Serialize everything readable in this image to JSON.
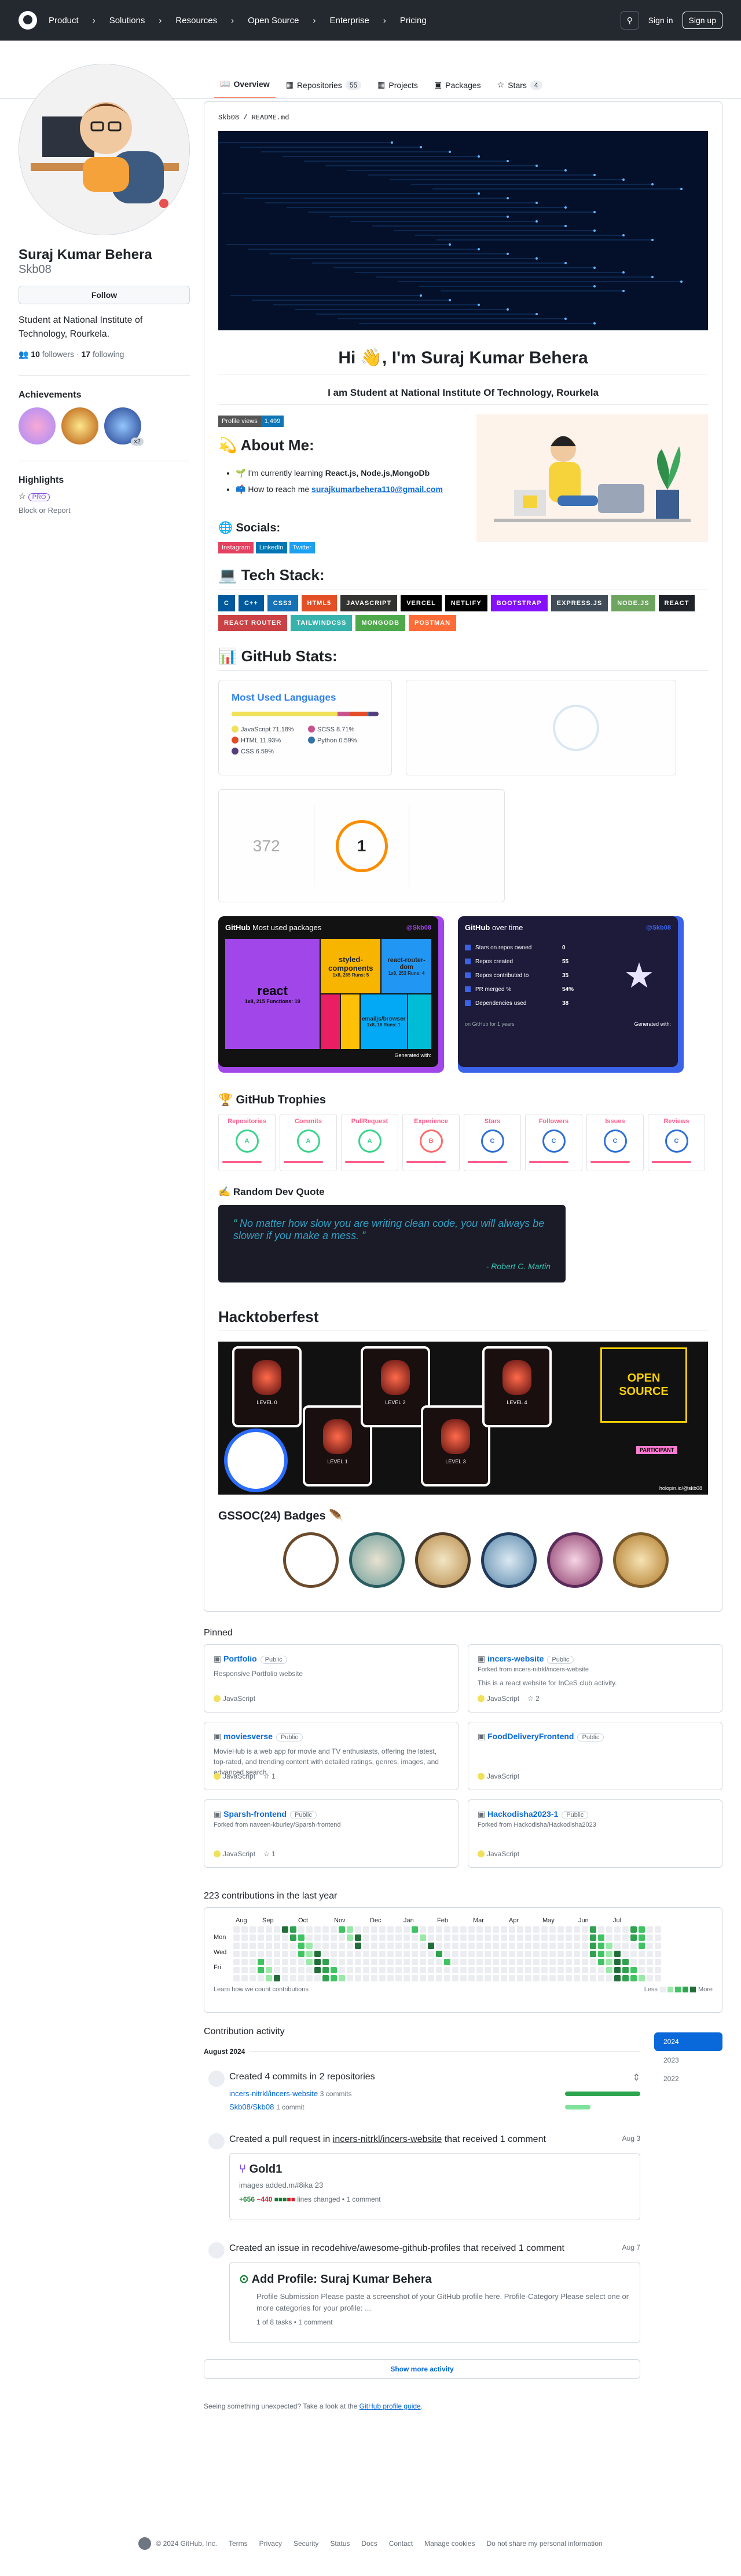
{
  "header": {
    "nav": [
      "Product",
      "Solutions",
      "Resources",
      "Open Source",
      "Enterprise",
      "Pricing"
    ],
    "sign_in": "Sign in",
    "sign_up": "Sign up",
    "search_key": "/"
  },
  "tabs": [
    {
      "label": "Overview"
    },
    {
      "label": "Repositories",
      "count": "55"
    },
    {
      "label": "Projects"
    },
    {
      "label": "Packages"
    },
    {
      "label": "Stars",
      "count": "4"
    }
  ],
  "profile": {
    "name": "Suraj Kumar Behera",
    "login": "Skb08",
    "follow": "Follow",
    "bio": "Student at National Institute of Technology, Rourkela.",
    "followers": "10",
    "followers_label": "followers",
    "following": "17",
    "following_label": "following",
    "achievements_title": "Achievements",
    "achievement_count": "x2",
    "highlights_title": "Highlights",
    "pro": "PRO",
    "block": "Block or Report"
  },
  "readme": {
    "path": "Skb08 / README.md",
    "greeting": "Hi 👋, I'm Suraj Kumar Behera",
    "subtitle": "I am Student at National Institute Of Technology, Rourkela",
    "profile_views_label": "Profile views",
    "profile_views": "1,499",
    "about_title": "💫 About Me:",
    "about_items": [
      {
        "pre": "🌱 I'm currently learning ",
        "bold": "React.js, Node.js,MongoDb"
      },
      {
        "pre": "📫 How to reach me ",
        "link": "surajkumarbehera110@gmail.com"
      }
    ],
    "socials_title": "🌐 Socials:",
    "socials": [
      {
        "label": "Instagram",
        "color": "#e4405f"
      },
      {
        "label": "LinkedIn",
        "color": "#0077b5"
      },
      {
        "label": "Twitter",
        "color": "#1ca0f1"
      }
    ],
    "tech_title": "💻 Tech Stack:",
    "tech": [
      {
        "label": "C",
        "color": "#00599c"
      },
      {
        "label": "C++",
        "color": "#00599c"
      },
      {
        "label": "CSS3",
        "color": "#1572b6"
      },
      {
        "label": "HTML5",
        "color": "#e34f26"
      },
      {
        "label": "JAVASCRIPT",
        "color": "#323330"
      },
      {
        "label": "VERCEL",
        "color": "#000000"
      },
      {
        "label": "NETLIFY",
        "color": "#000000"
      },
      {
        "label": "BOOTSTRAP",
        "color": "#8511fa"
      },
      {
        "label": "EXPRESS.JS",
        "color": "#404d59"
      },
      {
        "label": "NODE.JS",
        "color": "#6da55f"
      },
      {
        "label": "REACT",
        "color": "#20232a"
      },
      {
        "label": "REACT ROUTER",
        "color": "#ca4245"
      },
      {
        "label": "TAILWINDCSS",
        "color": "#38b2ac"
      },
      {
        "label": "MONGODB",
        "color": "#4ea94b"
      },
      {
        "label": "POSTMAN",
        "color": "#ff6c37"
      }
    ],
    "stats_title": "📊 GitHub Stats:",
    "langs_title": "Most Used Languages",
    "langs": [
      {
        "name": "JavaScript",
        "pct": "71.18%",
        "color": "#f1e05a"
      },
      {
        "name": "SCSS",
        "pct": "8.71%",
        "color": "#c6538c"
      },
      {
        "name": "HTML",
        "pct": "11.93%",
        "color": "#e34c26"
      },
      {
        "name": "Python",
        "pct": "0.59%",
        "color": "#3572a5"
      },
      {
        "name": "CSS",
        "pct": "6.59%",
        "color": "#563d7c"
      }
    ],
    "total": "372",
    "streak": "1",
    "packages_title": "Most used packages",
    "packages_user": "@Skb08",
    "packages": [
      {
        "name": "react",
        "sub": "1x8, 215 Functions: 19"
      },
      {
        "name": "styled-components",
        "sub": "1x8, 265 Runs: 5"
      },
      {
        "name": "react-router-dom",
        "sub": "1x8, 253 Runs: 4"
      },
      {
        "name": "emailjs/browser",
        "sub": "1x8, 18 Runs: 1"
      }
    ],
    "generated": "Generated with:",
    "overtime_title": "over time",
    "overtime_rows": [
      {
        "label": "Stars on repos owned",
        "value": "0"
      },
      {
        "label": "Repos created",
        "value": "55"
      },
      {
        "label": "Repos contributed to",
        "value": "35"
      },
      {
        "label": "PR merged %",
        "value": "54%"
      },
      {
        "label": "Dependencies used",
        "value": "38"
      }
    ],
    "overtime_period": "on GitHub for 1 years",
    "trophies_title": "🏆 GitHub Trophies",
    "trophies": [
      {
        "label": "Repositories",
        "rank": "A"
      },
      {
        "label": "Commits",
        "rank": "A"
      },
      {
        "label": "PullRequest",
        "rank": "A"
      },
      {
        "label": "Experience",
        "rank": "B"
      },
      {
        "label": "Stars",
        "rank": "C"
      },
      {
        "label": "Followers",
        "rank": "C"
      },
      {
        "label": "Issues",
        "rank": "C"
      },
      {
        "label": "Reviews",
        "rank": "C"
      }
    ],
    "quote_title": "✍️ Random Dev Quote",
    "quote": "No matter how slow you are writing clean code, you will always be slower if you make a mess.",
    "quote_author": "- Robert C. Martin",
    "hacktober_title": "Hacktoberfest",
    "hacktober_levels": [
      "LEVEL 0",
      "LEVEL 1",
      "LEVEL 2",
      "LEVEL 3",
      "LEVEL 4"
    ],
    "hacktober_open": "OPEN SOURCE",
    "hacktober_badge": "PARTICIPANT",
    "hacktober_user": "holopin.io/@skb08",
    "gssoc_title": "GSSOC(24) Badges 🪶"
  },
  "pinned": {
    "title": "Pinned",
    "items": [
      {
        "name": "Portfolio",
        "vis": "Public",
        "desc": "Responsive Portfolio website",
        "lang": "JavaScript",
        "stars": ""
      },
      {
        "name": "incers-website",
        "vis": "Public",
        "fork": "Forked from incers-nitrkl/incers-website",
        "desc": "This is a react website for InCeS club activity.",
        "lang": "JavaScript",
        "stars": "2"
      },
      {
        "name": "moviesverse",
        "vis": "Public",
        "desc": "MovieHub is a web app for movie and TV enthusiasts, offering the latest, top-rated, and trending content with detailed ratings, genres, images, and advanced search.",
        "lang": "JavaScript",
        "stars": "1"
      },
      {
        "name": "FoodDeliveryFrontend",
        "vis": "Public",
        "desc": "",
        "lang": "JavaScript",
        "stars": ""
      },
      {
        "name": "Sparsh-frontend",
        "vis": "Public",
        "fork": "Forked from naveen-kburley/Sparsh-frontend",
        "desc": "",
        "lang": "JavaScript",
        "stars": "1"
      },
      {
        "name": "Hackodisha2023-1",
        "vis": "Public",
        "fork": "Forked from Hackodisha/Hackodisha2023",
        "desc": "",
        "lang": "JavaScript",
        "stars": ""
      }
    ]
  },
  "contrib": {
    "title": "223 contributions in the last year",
    "months": [
      "Aug",
      "Sep",
      "Oct",
      "Nov",
      "Dec",
      "Jan",
      "Feb",
      "Mar",
      "Apr",
      "May",
      "Jun",
      "Jul"
    ],
    "days": [
      "Mon",
      "Wed",
      "Fri"
    ],
    "learn": "Learn how we count contributions",
    "less": "Less",
    "more": "More"
  },
  "activity": {
    "title": "Contribution activity",
    "years": [
      "2024",
      "2023",
      "2022"
    ],
    "month": "August 2024",
    "commits": {
      "title": "Created 4 commits in 2 repositories",
      "repos": [
        {
          "name": "incers-nitrkl/incers-website",
          "count": "3 commits"
        },
        {
          "name": "Skb08/Skb08",
          "count": "1 commit"
        }
      ]
    },
    "pr": {
      "title_pre": "Created a pull request in ",
      "repo": "incers-nitrkl/incers-website",
      "title_post": " that received 1 comment",
      "date": "Aug 3",
      "pr_title": "Gold1",
      "pr_body": "images added.m#8ika 23",
      "add": "+656",
      "del": "−440",
      "lines": "lines changed",
      "comments": "1 comment"
    },
    "issue": {
      "title": "Created an issue in recodehive/awesome-github-profiles that received 1 comment",
      "date": "Aug 7",
      "issue_title": "Add Profile: Suraj Kumar Behera",
      "issue_body": "Profile Submission Please paste a screenshot of your GitHub profile here. Profile-Category Please select one or more categories for your profile: ...",
      "tasks": "1 of 8 tasks",
      "comments": "1 comment"
    },
    "show_more": "Show more activity",
    "unexpected_pre": "Seeing something unexpected? Take a look at the ",
    "unexpected_link": "GitHub profile guide",
    "unexpected_post": "."
  },
  "footer": {
    "copy": "© 2024 GitHub, Inc.",
    "links": [
      "Terms",
      "Privacy",
      "Security",
      "Status",
      "Docs",
      "Contact",
      "Manage cookies",
      "Do not share my personal information"
    ]
  }
}
